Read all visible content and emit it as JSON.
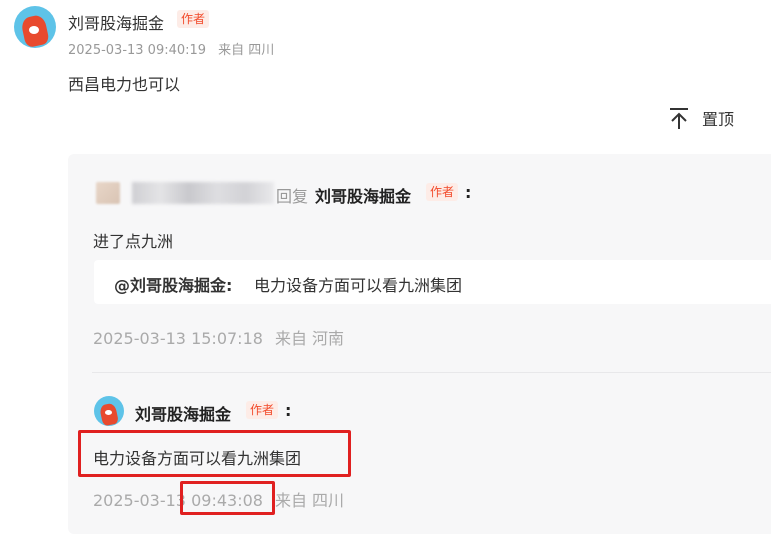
{
  "comment": {
    "author": "刘哥股海掘金",
    "badge": "作者",
    "timestamp": "2025-03-13 09:40:19",
    "location": "来自 四川",
    "text": "西昌电力也可以",
    "pin_label": "置顶"
  },
  "reply1": {
    "reply_word": "回复",
    "target": "刘哥股海掘金",
    "badge": "作者",
    "colon": ":",
    "text": "进了点九洲",
    "quote_user": "@刘哥股海掘金:",
    "quote_text": "电力设备方面可以看九洲集团",
    "timestamp": "2025-03-13 15:07:18",
    "location": "来自 河南"
  },
  "reply2": {
    "author": "刘哥股海掘金",
    "badge": "作者",
    "colon": ":",
    "text": "电力设备方面可以看九洲集团",
    "date": "2025-03-13",
    "time": "09:43:08",
    "location": "来自 四川"
  },
  "colors": {
    "badge": "#f24a2a",
    "highlight": "#e02020",
    "avatar_bg": "#5ec3e8"
  }
}
